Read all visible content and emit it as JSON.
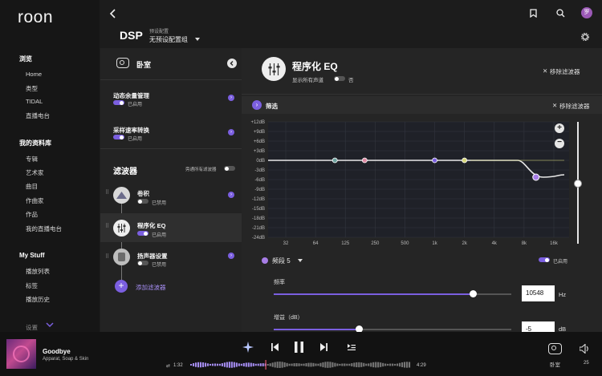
{
  "app": {
    "logo": "roon"
  },
  "sidebar": {
    "browse_heading": "浏览",
    "browse_items": [
      "Home",
      "类型",
      "TIDAL",
      "直播电台"
    ],
    "library_heading": "我的资料库",
    "library_items": [
      "专辑",
      "艺术家",
      "曲目",
      "作曲家",
      "作品",
      "我的直播电台"
    ],
    "mystuff_heading": "My Stuff",
    "mystuff_items": [
      "播放列表",
      "标签",
      "播放历史"
    ],
    "settings_label": "设置"
  },
  "header": {
    "title": "DSP",
    "preset_label": "预设配置",
    "preset_value": "无预设配置组",
    "avatar_initial": "罗"
  },
  "zone": {
    "name": "卧室",
    "volume_leveling": {
      "label": "动态余量管理",
      "status": "已启用"
    },
    "sample_rate": {
      "label": "采样速率转换",
      "status": "已启用"
    },
    "filters_heading": "滤波器",
    "bypass_label": "旁通所有滤波器",
    "filters": [
      {
        "name": "卷积",
        "status": "已禁用"
      },
      {
        "name": "程序化 EQ",
        "status": "已启用"
      },
      {
        "name": "扬声器设置",
        "status": "已禁用"
      }
    ],
    "add_filter_label": "添加滤波器"
  },
  "eq": {
    "title": "程序化 EQ",
    "show_all_channels_label": "显示所有声道",
    "show_all_channels_value": "否",
    "remove_filter_label": "移除滤波器",
    "filter_section_label": "筛选",
    "filter_remove_label": "移除滤波器",
    "y_ticks": [
      "+12dB",
      "+9dB",
      "+6dB",
      "+3dB",
      "0dB",
      "-3dB",
      "-6dB",
      "-9dB",
      "-12dB",
      "-15dB",
      "-18dB",
      "-21dB",
      "-24dB"
    ],
    "x_ticks": [
      "32",
      "64",
      "125",
      "250",
      "500",
      "1k",
      "2k",
      "4k",
      "8k",
      "16k"
    ],
    "band_label": "频段 5",
    "band_status": "已启用",
    "frequency_label": "频率",
    "frequency_value": "10548",
    "frequency_unit": "Hz",
    "frequency_fraction": 0.84,
    "gain_label": "增益（dB）",
    "gain_value": "-5",
    "gain_unit": "dB",
    "gain_fraction": 0.36,
    "colors": {
      "accent": "#7b5fe0",
      "curve": "#e8e8e8"
    }
  },
  "player": {
    "track": "Goodbye",
    "artist": "Apparat, Soap & Skin",
    "elapsed": "1:32",
    "duration": "4:29",
    "progress_fraction": 0.34,
    "zone_label": "卧室",
    "volume": "25"
  }
}
